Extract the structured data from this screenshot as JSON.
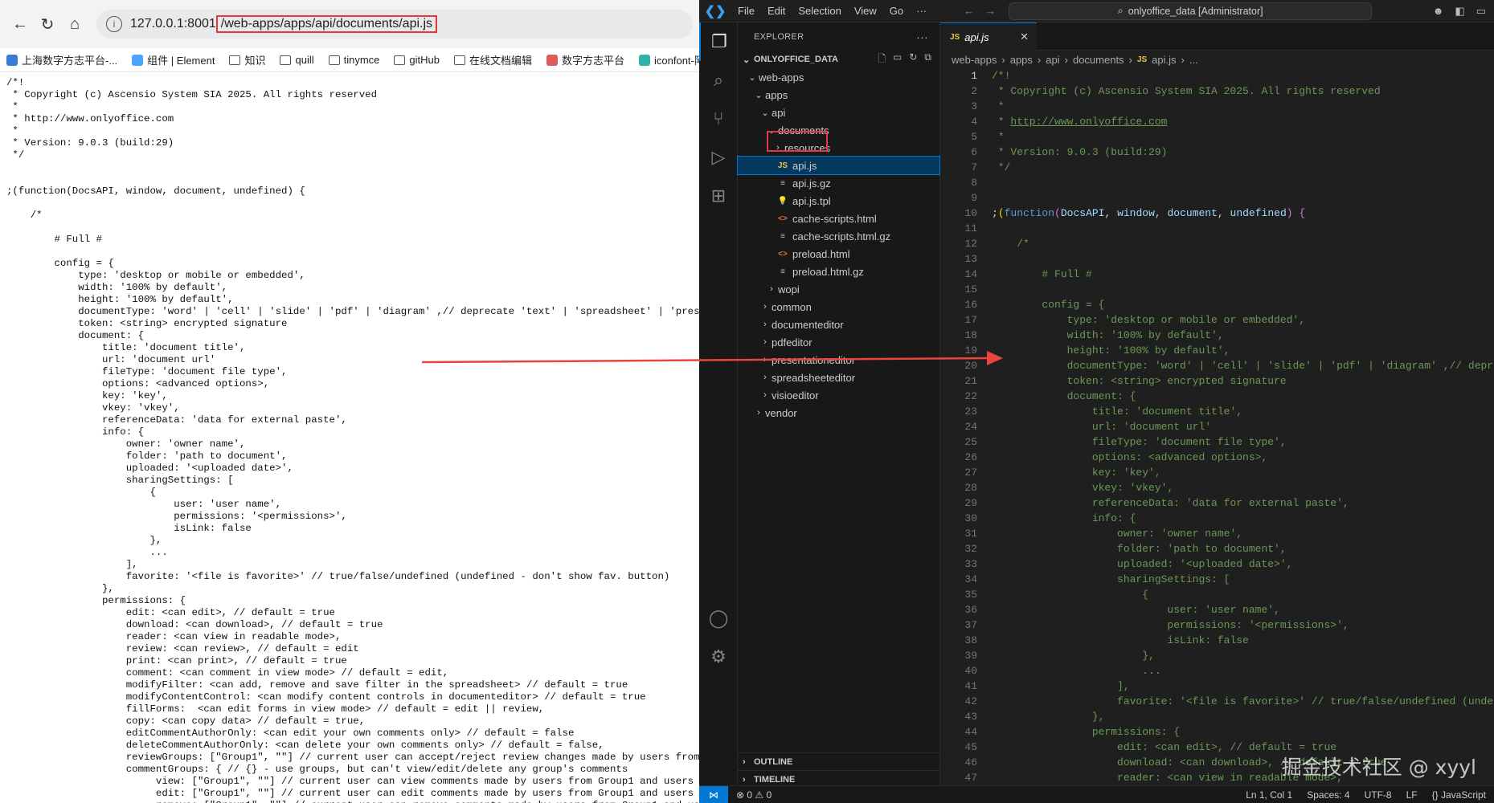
{
  "browser": {
    "url_host": "127.0.0.1:8001",
    "url_path": "/web-apps/apps/api/documents/api.js",
    "bookmarks": [
      "上海数字方志平台-...",
      "组件 | Element",
      "知识",
      "quill",
      "tinymce",
      "gitHub",
      "在线文档编辑",
      "数字方志平台",
      "iconfont-阿里"
    ],
    "source_text": "/*!\n * Copyright (c) Ascensio System SIA 2025. All rights reserved\n *\n * http://www.onlyoffice.com\n *\n * Version: 9.0.3 (build:29)\n */\n\n\n;(function(DocsAPI, window, document, undefined) {\n\n    /*\n\n        # Full #\n\n        config = {\n            type: 'desktop or mobile or embedded',\n            width: '100% by default',\n            height: '100% by default',\n            documentType: 'word' | 'cell' | 'slide' | 'pdf' | 'diagram' ,// deprecate 'text' | 'spreadsheet' | 'presentation',\n            token: <string> encrypted signature\n            document: {\n                title: 'document title',\n                url: 'document url'\n                fileType: 'document file type',\n                options: <advanced options>,\n                key: 'key',\n                vkey: 'vkey',\n                referenceData: 'data for external paste',\n                info: {\n                    owner: 'owner name',\n                    folder: 'path to document',\n                    uploaded: '<uploaded date>',\n                    sharingSettings: [\n                        {\n                            user: 'user name',\n                            permissions: '<permissions>',\n                            isLink: false\n                        },\n                        ...\n                    ],\n                    favorite: '<file is favorite>' // true/false/undefined (undefined - don't show fav. button)\n                },\n                permissions: {\n                    edit: <can edit>, // default = true\n                    download: <can download>, // default = true\n                    reader: <can view in readable mode>,\n                    review: <can review>, // default = edit\n                    print: <can print>, // default = true\n                    comment: <can comment in view mode> // default = edit,\n                    modifyFilter: <can add, remove and save filter in the spreadsheet> // default = true\n                    modifyContentControl: <can modify content controls in documenteditor> // default = true\n                    fillForms:  <can edit forms in view mode> // default = edit || review,\n                    copy: <can copy data> // default = true,\n                    editCommentAuthorOnly: <can edit your own comments only> // default = false\n                    deleteCommentAuthorOnly: <can delete your own comments only> // default = false,\n                    reviewGroups: [\"Group1\", \"\"] // current user can accept/reject review changes made by users from Group1\n                    commentGroups: { // {} - use groups, but can't view/edit/delete any group's comments\n                         view: [\"Group1\", \"\"] // current user can view comments made by users from Group1 and users without\n                         edit: [\"Group1\", \"\"] // current user can edit comments made by users from Group1 and users without\n                         remove: [\"Group1\", \"\"] // current user can remove comments made by users from Group1 and users without"
  },
  "vscode": {
    "menu": [
      "File",
      "Edit",
      "Selection",
      "View",
      "Go",
      "···"
    ],
    "command_center": "onlyoffice_data [Administrator]",
    "explorer_header": "EXPLORER",
    "workspace": "ONLYOFFICE_DATA",
    "tree": [
      {
        "label": "web-apps",
        "depth": 1,
        "type": "folder-open"
      },
      {
        "label": "apps",
        "depth": 2,
        "type": "folder-open"
      },
      {
        "label": "api",
        "depth": 3,
        "type": "folder-open"
      },
      {
        "label": "documents",
        "depth": 4,
        "type": "folder-open"
      },
      {
        "label": "resources",
        "depth": 5,
        "type": "folder"
      },
      {
        "label": "api.js",
        "depth": 5,
        "type": "js",
        "selected": true
      },
      {
        "label": "api.js.gz",
        "depth": 5,
        "type": "gz"
      },
      {
        "label": "api.js.tpl",
        "depth": 5,
        "type": "tpl"
      },
      {
        "label": "cache-scripts.html",
        "depth": 5,
        "type": "html"
      },
      {
        "label": "cache-scripts.html.gz",
        "depth": 5,
        "type": "gz"
      },
      {
        "label": "preload.html",
        "depth": 5,
        "type": "html"
      },
      {
        "label": "preload.html.gz",
        "depth": 5,
        "type": "gz"
      },
      {
        "label": "wopi",
        "depth": 4,
        "type": "folder"
      },
      {
        "label": "common",
        "depth": 3,
        "type": "folder"
      },
      {
        "label": "documenteditor",
        "depth": 3,
        "type": "folder"
      },
      {
        "label": "pdfeditor",
        "depth": 3,
        "type": "folder"
      },
      {
        "label": "presentationeditor",
        "depth": 3,
        "type": "folder"
      },
      {
        "label": "spreadsheeteditor",
        "depth": 3,
        "type": "folder"
      },
      {
        "label": "visioeditor",
        "depth": 3,
        "type": "folder"
      },
      {
        "label": "vendor",
        "depth": 2,
        "type": "folder"
      }
    ],
    "outline": "OUTLINE",
    "timeline": "TIMELINE",
    "tab_label": "api.js",
    "breadcrumb": [
      "web-apps",
      "apps",
      "api",
      "documents",
      "api.js",
      "..."
    ],
    "code_lines": [
      "/*!",
      " * Copyright (c) Ascensio System SIA 2025. All rights reserved",
      " *",
      " * http://www.onlyoffice.com",
      " *",
      " * Version: 9.0.3 (build:29)",
      " */",
      "",
      "",
      ";(function(DocsAPI, window, document, undefined) {",
      "",
      "    /*",
      "",
      "        # Full #",
      "",
      "        config = {",
      "            type: 'desktop or mobile or embedded',",
      "            width: '100% by default',",
      "            height: '100% by default',",
      "            documentType: 'word' | 'cell' | 'slide' | 'pdf' | 'diagram' ,// deprecate 'text' | 'spreadsheet' | 'presentation',",
      "            token: <string> encrypted signature",
      "            document: {",
      "                title: 'document title',",
      "                url: 'document url'",
      "                fileType: 'document file type',",
      "                options: <advanced options>,",
      "                key: 'key',",
      "                vkey: 'vkey',",
      "                referenceData: 'data for external paste',",
      "                info: {",
      "                    owner: 'owner name',",
      "                    folder: 'path to document',",
      "                    uploaded: '<uploaded date>',",
      "                    sharingSettings: [",
      "                        {",
      "                            user: 'user name',",
      "                            permissions: '<permissions>',",
      "                            isLink: false",
      "                        },",
      "                        ...",
      "                    ],",
      "                    favorite: '<file is favorite>' // true/false/undefined (undefined - don't show fav. button)",
      "                },",
      "                permissions: {",
      "                    edit: <can edit>, // default = true",
      "                    download: <can download>, // default = true",
      "                    reader: <can view in readable mode>,"
    ],
    "status": {
      "errors": "⊗ 0 ⚠ 0",
      "position": "Ln 1, Col 1",
      "spaces": "Spaces: 4",
      "encoding": "UTF-8",
      "eol": "LF",
      "language": "{} JavaScript"
    }
  },
  "watermark": "掘金技术社区 @ xyyl"
}
